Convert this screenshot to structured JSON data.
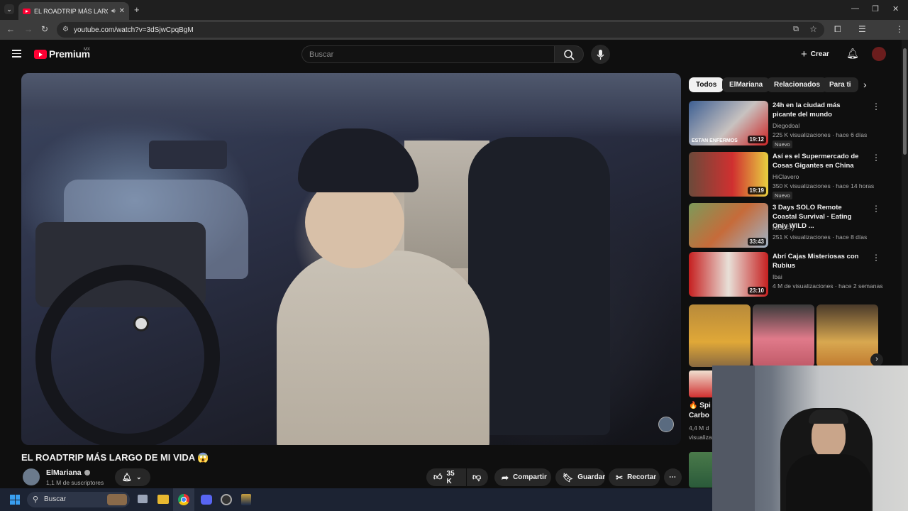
{
  "browser": {
    "tab_title": "EL ROADTRIP MÁS LARGO",
    "url": "youtube.com/watch?v=3dSjwCpqBgM"
  },
  "header": {
    "brand": "Premium",
    "region": "MX",
    "search_placeholder": "Buscar",
    "create_label": "Crear"
  },
  "video": {
    "title": "EL ROADTRIP MÁS LARGO DE MI VIDA 😱",
    "channel": "ElMariana",
    "subscribers": "1,1 M de suscriptores",
    "likes": "35 K",
    "share_label": "Compartir",
    "save_label": "Guardar",
    "clip_label": "Recortar"
  },
  "sidebar": {
    "chips": [
      "Todos",
      "ElMariana",
      "Relacionados",
      "Para ti"
    ],
    "recommendations": [
      {
        "title": "24h en la ciudad más picante del mundo",
        "channel": "Diegodoal",
        "meta": "225 K visualizaciones · hace 6 días",
        "duration": "19:12",
        "badge": "Nuevo",
        "thumb_text": "ESTAN ENFERMOS"
      },
      {
        "title": "Así es el Supermercado de Cosas Gigantes en China",
        "channel": "HiClavero",
        "meta": "350 K visualizaciones · hace 14 horas",
        "duration": "19:19",
        "badge": "Nuevo"
      },
      {
        "title": "3 Days SOLO Remote Coastal Survival - Eating Only WILD ...",
        "channel": "Nick Fry",
        "meta": "251 K visualizaciones · hace 8 días",
        "duration": "33:43"
      },
      {
        "title": "Abrí Cajas Misteriosas con Rubius",
        "channel": "Ibai",
        "meta": "4 M de visualizaciones · hace 2 semanas",
        "duration": "23:10"
      }
    ],
    "partial_title_1": "🔥 Spi",
    "partial_title_2": "Carbo",
    "partial_meta_1": "4,4 M d",
    "partial_meta_2": "visualiza"
  },
  "taskbar": {
    "search_label": "Buscar"
  }
}
